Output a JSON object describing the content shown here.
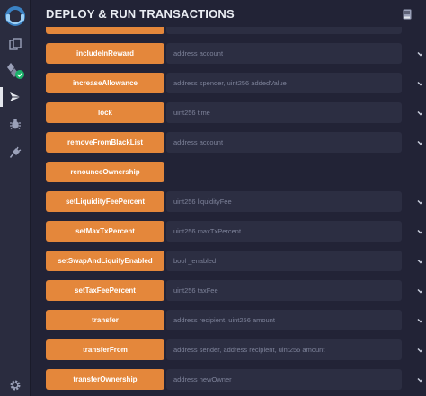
{
  "header": {
    "title": "DEPLOY & RUN TRANSACTIONS"
  },
  "icons": {
    "logo": "remix-logo-icon",
    "file_explorer": "files-icon",
    "compiler": "solidity-compiler-icon",
    "deploy": "deploy-run-icon",
    "debugger": "bug-icon",
    "plugins": "plug-icon",
    "settings": "gear-icon",
    "docs": "book-icon",
    "expand": "chevron-down-icon"
  },
  "functions": [
    {
      "name": "",
      "placeholder": ""
    },
    {
      "name": "includeInReward",
      "placeholder": "address account"
    },
    {
      "name": "increaseAllowance",
      "placeholder": "address spender, uint256 addedValue"
    },
    {
      "name": "lock",
      "placeholder": "uint256 time"
    },
    {
      "name": "removeFromBlackList",
      "placeholder": "address account"
    },
    {
      "name": "renounceOwnership",
      "placeholder": ""
    },
    {
      "name": "setLiquidityFeePercent",
      "placeholder": "uint256 liquidityFee"
    },
    {
      "name": "setMaxTxPercent",
      "placeholder": "uint256 maxTxPercent"
    },
    {
      "name": "setSwapAndLiquifyEnabled",
      "placeholder": "bool _enabled"
    },
    {
      "name": "setTaxFeePercent",
      "placeholder": "uint256 taxFee"
    },
    {
      "name": "transfer",
      "placeholder": "address recipient, uint256 amount"
    },
    {
      "name": "transferFrom",
      "placeholder": "address sender, address recipient, uint256 amount"
    },
    {
      "name": "transferOwnership",
      "placeholder": "address newOwner"
    }
  ],
  "colors": {
    "button": "#e4873b",
    "panel_bg": "#222336",
    "input_bg": "#2c2e42",
    "iconbar_bg": "#2a2c3f",
    "compile_ok": "#1cb36b"
  }
}
